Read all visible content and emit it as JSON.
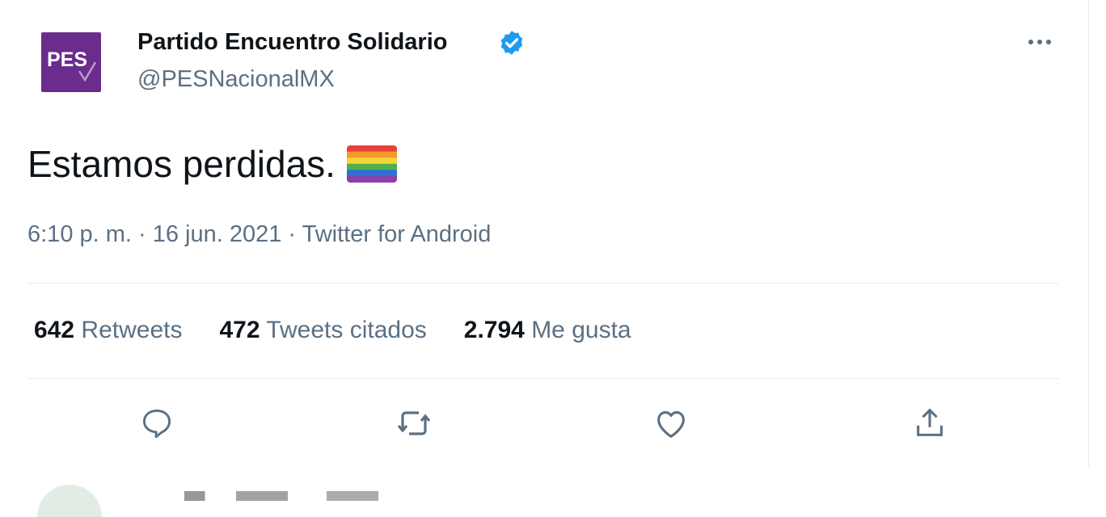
{
  "tweet": {
    "author": {
      "display_name": "Partido Encuentro Solidario",
      "handle": "@PESNacionalMX",
      "avatar_text": "PES",
      "verified": true
    },
    "text": "Estamos perdidas.",
    "emoji": "rainbow-flag",
    "meta": "6:10 p. m. · 16 jun. 2021 · Twitter for Android",
    "stats": {
      "retweets_count": "642",
      "retweets_label": "Retweets",
      "quotes_count": "472",
      "quotes_label": "Tweets citados",
      "likes_count": "2.794",
      "likes_label": "Me gusta"
    },
    "actions": [
      "reply-icon",
      "retweet-icon",
      "like-icon",
      "share-icon"
    ]
  },
  "colors": {
    "brand_purple": "#6a2d8c",
    "verified_blue": "#1d9bf0",
    "secondary_text": "#5b7083",
    "divider": "#e6ecf0"
  }
}
